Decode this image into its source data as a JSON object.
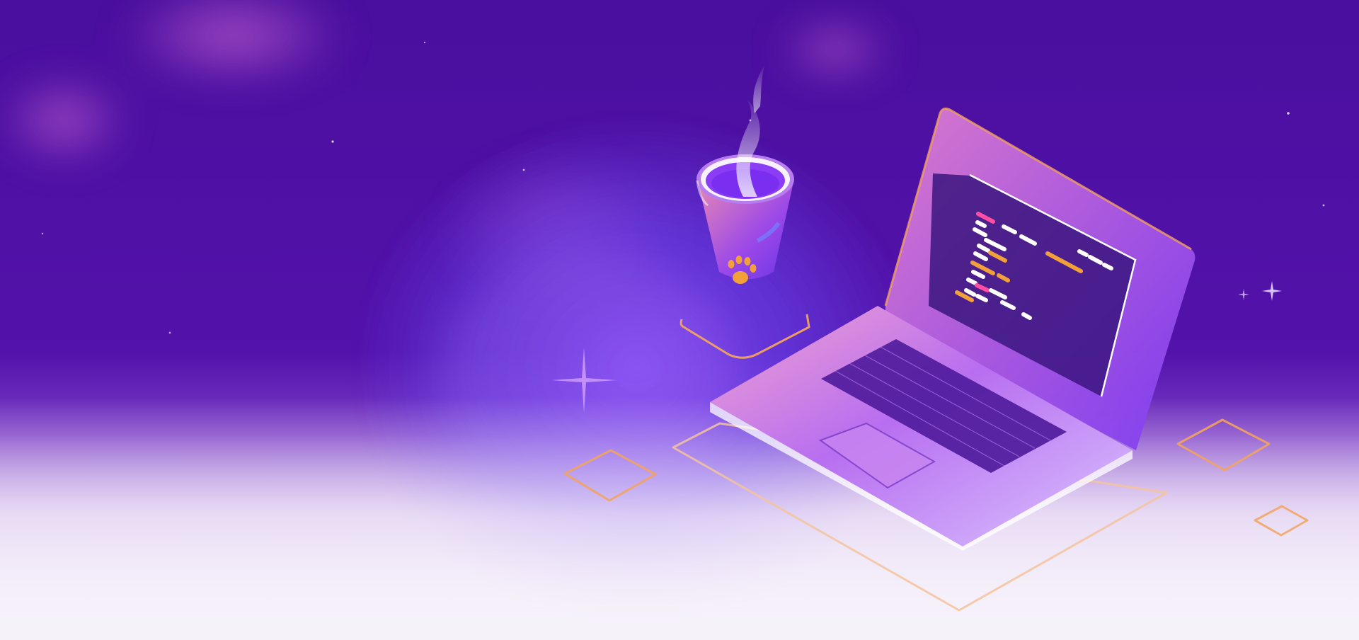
{
  "scene": {
    "palette": {
      "sky_top": "#4a0f9e",
      "sky_mid": "#5a17b8",
      "nebula_blue": "#6b4df0",
      "nebula_pink": "#c56bd6",
      "fade_white": "#f4eef8",
      "outline_orange": "#f2a35f",
      "laptop_pink": "#e08ad8",
      "laptop_violet": "#8b3cf0",
      "screen_dark": "#3b157f",
      "code_pink": "#ff4fa3",
      "code_orange": "#f2a13a",
      "code_white": "#ffffff",
      "paw_orange": "#f2a13a"
    },
    "icons": [
      "coffee-cup-icon",
      "paw-print-icon",
      "laptop-icon",
      "code-editor-icon",
      "steam-icon",
      "isometric-tile-icon",
      "star-icon"
    ]
  }
}
